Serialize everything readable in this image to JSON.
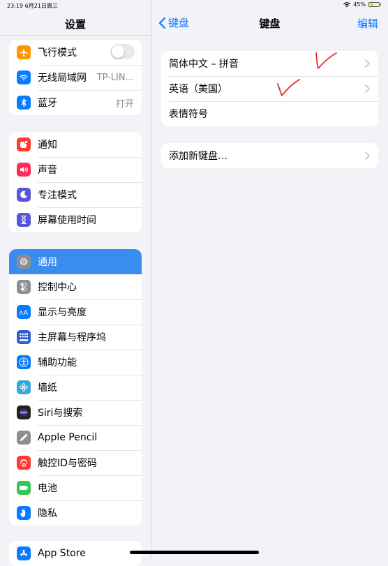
{
  "status_bar": {
    "time": "23:19",
    "date": "6月21日周三",
    "battery": "45%",
    "battery_level": 0.45
  },
  "sidebar": {
    "title": "设置",
    "group1": [
      {
        "label": "飞行模式",
        "icon": "airplane-icon",
        "color": "#ff9500",
        "toggle": false
      },
      {
        "label": "无线局域网",
        "icon": "wifi-icon",
        "color": "#0a7aff",
        "value": "TP-LIN..."
      },
      {
        "label": "蓝牙",
        "icon": "bluetooth-icon",
        "color": "#0a7aff",
        "value": "打开"
      }
    ],
    "group2": [
      {
        "label": "通知",
        "icon": "notification-icon",
        "color": "#ff3b30"
      },
      {
        "label": "声音",
        "icon": "speaker-icon",
        "color": "#ff2d55"
      },
      {
        "label": "专注模式",
        "icon": "moon-icon",
        "color": "#5856d6"
      },
      {
        "label": "屏幕使用时间",
        "icon": "hourglass-icon",
        "color": "#5856d6"
      }
    ],
    "group3": [
      {
        "label": "通用",
        "icon": "gear-icon",
        "color": "#8e8e93",
        "selected": true
      },
      {
        "label": "控制中心",
        "icon": "toggles-icon",
        "color": "#8e8e93"
      },
      {
        "label": "显示与亮度",
        "icon": "text-size-icon",
        "color": "#0a7aff"
      },
      {
        "label": "主屏幕与程序坞",
        "icon": "home-grid-icon",
        "color": "#2c5ed8"
      },
      {
        "label": "辅助功能",
        "icon": "accessibility-icon",
        "color": "#0a7aff"
      },
      {
        "label": "墙纸",
        "icon": "flower-icon",
        "color": "#34aadc"
      },
      {
        "label": "Siri与搜索",
        "icon": "siri-icon",
        "color": "#222222"
      },
      {
        "label": "Apple Pencil",
        "icon": "pencil-icon",
        "color": "#8e8e93"
      },
      {
        "label": "触控ID与密码",
        "icon": "fingerprint-icon",
        "color": "#ff3b30"
      },
      {
        "label": "电池",
        "icon": "battery-icon",
        "color": "#34c759"
      },
      {
        "label": "隐私",
        "icon": "hand-icon",
        "color": "#0a7aff"
      }
    ],
    "group4": [
      {
        "label": "App Store",
        "icon": "app-store-icon",
        "color": "#0a7aff"
      }
    ]
  },
  "detail": {
    "back_label": "键盘",
    "title": "键盘",
    "edit_label": "编辑",
    "keyboards": [
      {
        "label": "简体中文 – 拼音",
        "chevron": true
      },
      {
        "label": "英语（美国）",
        "chevron": true
      },
      {
        "label": "表情符号",
        "chevron": false
      }
    ],
    "add_keyboard": "添加新键盘…",
    "accent_color": "#0a7aff",
    "annotation_color": "#e0302e"
  }
}
